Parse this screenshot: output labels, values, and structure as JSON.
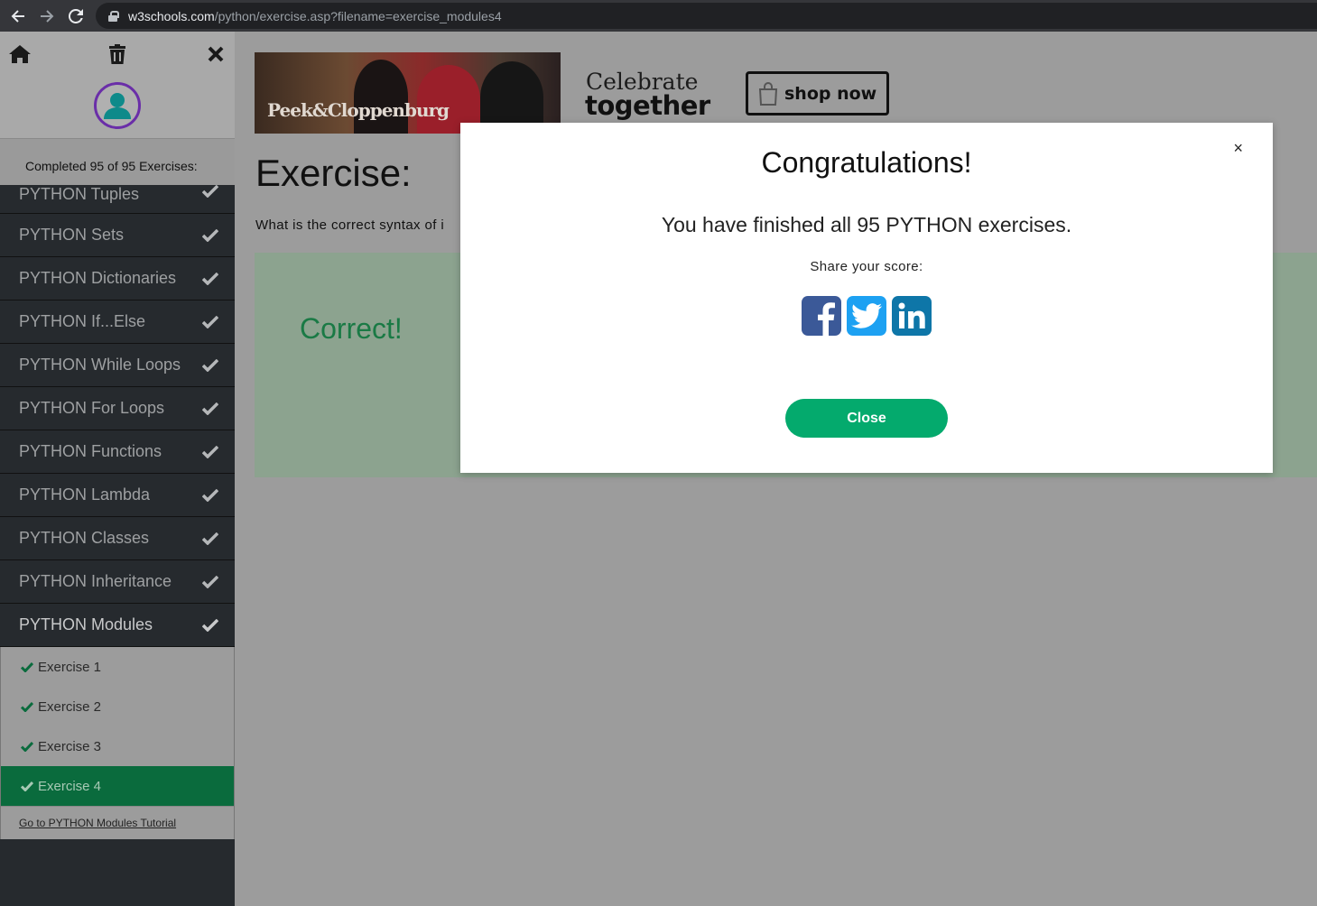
{
  "browser": {
    "url_domain": "w3schools.com",
    "url_path": "/python/exercise.asp?filename=exercise_modules4"
  },
  "sidebar": {
    "completed_text": "Completed 95 of 95 Exercises:",
    "chapters": [
      {
        "label": "PYTHON Tuples"
      },
      {
        "label": "PYTHON Sets"
      },
      {
        "label": "PYTHON Dictionaries"
      },
      {
        "label": "PYTHON If...Else"
      },
      {
        "label": "PYTHON While Loops"
      },
      {
        "label": "PYTHON For Loops"
      },
      {
        "label": "PYTHON Functions"
      },
      {
        "label": "PYTHON Lambda"
      },
      {
        "label": "PYTHON Classes"
      },
      {
        "label": "PYTHON Inheritance"
      },
      {
        "label": "PYTHON Modules"
      }
    ],
    "exercises": [
      {
        "label": "Exercise 1"
      },
      {
        "label": "Exercise 2"
      },
      {
        "label": "Exercise 3"
      },
      {
        "label": "Exercise 4"
      }
    ],
    "tutorial_link": "Go to PYTHON Modules Tutorial"
  },
  "ad": {
    "brand": "Peek&Cloppenburg",
    "line1": "Celebrate",
    "line2": "together",
    "cta": "shop now"
  },
  "main": {
    "title": "Exercise:",
    "question": "What is the correct syntax of i",
    "result": "Correct!"
  },
  "modal": {
    "title": "Congratulations!",
    "message": "You have finished all 95 PYTHON exercises.",
    "share_label": "Share your score:",
    "close_x": "×",
    "close_button": "Close"
  },
  "colors": {
    "accent_green": "#04aa6d",
    "current_exercise_bg": "#0a6b3d",
    "avatar_ring": "#6a2ea8"
  }
}
